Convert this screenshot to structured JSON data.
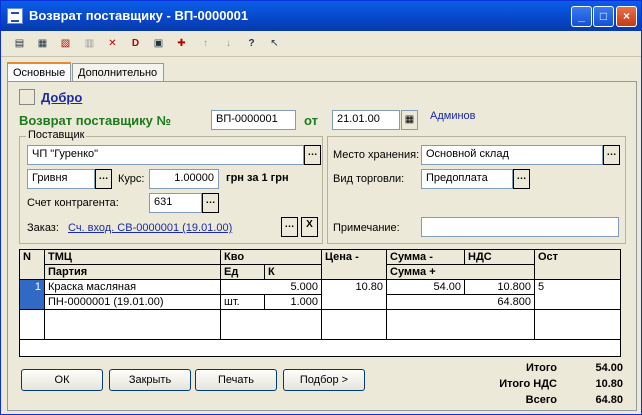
{
  "window": {
    "title": "Возврат поставщику - ВП-0000001",
    "minimize": "_",
    "maximize": "□",
    "close": "×"
  },
  "toolbar_icons": [
    "new-doc-icon",
    "copy-doc-icon",
    "delete-doc-icon",
    "cut-icon",
    "mark-delete-icon",
    "unpost-icon",
    "post-icon",
    "move-icon",
    "sort-asc-icon",
    "sort-desc-icon",
    "help-icon",
    "whatsthis-icon"
  ],
  "tabs": [
    "Основные",
    "Дополнительно"
  ],
  "header": {
    "dobro": "Добро",
    "doc_label": "Возврат поставщику №",
    "doc_number": "ВП-0000001",
    "from_label": "от",
    "date": "21.01.00",
    "user": "Админов"
  },
  "supplier": {
    "group_title": "Поставщик",
    "name": "ЧП \"Гуренко\"",
    "currency": "Гривня",
    "rate_label": "Курс:",
    "rate": "1.00000",
    "rate_suffix": "грн за 1 грн",
    "account_label": "Счет контрагента:",
    "account": "631",
    "order_label": "Заказ:",
    "order": "Сч. вход. СВ-0000001 (19.01.00)",
    "order_clear": "X"
  },
  "right": {
    "storage_label": "Место хранения:",
    "storage": "Основной склад",
    "trade_label": "Вид торговли:",
    "trade": "Предоплата",
    "note_label": "Примечание:",
    "note": ""
  },
  "grid": {
    "headers": {
      "n": "N",
      "tmc": "ТМЦ",
      "party": "Партия",
      "kvo": "Кво",
      "ed": "Ед",
      "k": "К",
      "price": "Цена -",
      "sum_minus": "Сумма -",
      "nds": "НДС",
      "sum_plus": "Сумма +",
      "ost": "Ост"
    },
    "rows": [
      {
        "n": "1",
        "tmc": "Краска масляная",
        "party": "ПН-0000001 (19.01.00)",
        "kvo": "5.000",
        "ed": "шт.",
        "k": "1.000",
        "price": "10.80",
        "sum_minus": "54.00",
        "nds": "10.800",
        "sum_plus": "64.800",
        "ost": "5"
      }
    ]
  },
  "buttons": {
    "ok": "ОК",
    "close": "Закрыть",
    "print": "Печать",
    "select": "Подбор >"
  },
  "totals": {
    "itogo_label": "Итого",
    "itogo": "54.00",
    "nds_label": "Итого НДС",
    "nds": "10.80",
    "total_label": "Всего",
    "total": "64.80"
  }
}
